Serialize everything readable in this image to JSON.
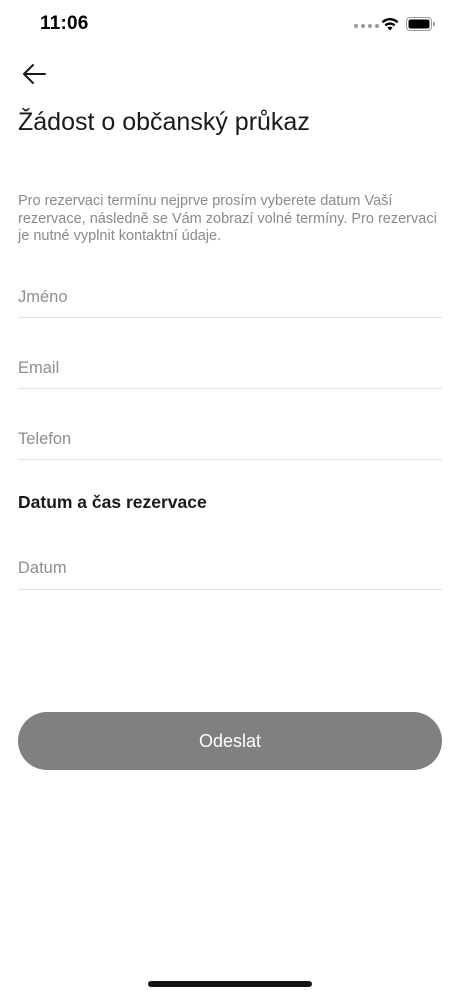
{
  "status_bar": {
    "time": "11:06",
    "icons": [
      "signal-dots-icon",
      "wifi-icon",
      "battery-icon"
    ]
  },
  "header": {
    "back_icon": "arrow-left-icon",
    "title": "Žádost o občanský průkaz"
  },
  "intro": "Pro rezervaci termínu nejprve prosím vyberete datum Vaší rezervace, následně se Vám zobrazí volné termíny. Pro rezervaci je nutné vyplnit kontaktní údaje.",
  "form": {
    "name": {
      "placeholder": "Jméno",
      "value": ""
    },
    "email": {
      "placeholder": "Email",
      "value": ""
    },
    "phone": {
      "placeholder": "Telefon",
      "value": ""
    },
    "reservation_heading": "Datum a čas rezervace",
    "date": {
      "placeholder": "Datum",
      "value": ""
    },
    "submit_label": "Odeslat"
  },
  "colors": {
    "text": "#1a1a1a",
    "muted": "#8a8a8a",
    "divider": "#e2e2e2",
    "button_bg": "#808080",
    "button_text": "#ffffff"
  }
}
